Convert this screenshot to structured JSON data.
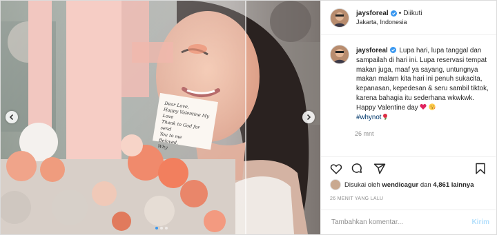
{
  "header": {
    "username": "jaysforeal",
    "separator": "•",
    "follow_status": "Diikuti",
    "location": "Jakarta, Indonesia"
  },
  "caption": {
    "username": "jaysforeal",
    "text": "Lupa hari, lupa tanggal dan sampailah di hari ini. Lupa reservasi tempat makan juga, maaf ya sayang, untungnya makan malam kita hari ini penuh sukacita, kepanasan, kepedesan & seru sambil tiktok, karena bahagia itu sederhana wkwkwk. Happy Valentine day",
    "hashtag": "#whynot",
    "time_ago": "26 mnt"
  },
  "photo": {
    "card_note": "Dear Love,\nHappy Valentine My Love\nThank to God for send\nYou to me\nBeloved,\nWhy",
    "carousel_total": 3,
    "carousel_active": 1
  },
  "likes": {
    "prefix": "Disukai oleh",
    "first_liker": "wendicagur",
    "connector": "dan",
    "count_text": "4,861 lainnya"
  },
  "posted_time": "26 MENIT YANG LALU",
  "comment_box": {
    "placeholder": "Tambahkan komentar...",
    "post_label": "Kirim"
  },
  "icons": {
    "like": "heart-outline-icon",
    "comment": "speech-bubble-icon",
    "share": "paper-plane-icon",
    "save": "bookmark-icon",
    "verified": "verified-badge-icon"
  },
  "colors": {
    "verified_blue": "#3897f0",
    "hashtag": "#00376b",
    "muted": "#8e8e8e",
    "post_button_disabled": "#b2dffc"
  }
}
